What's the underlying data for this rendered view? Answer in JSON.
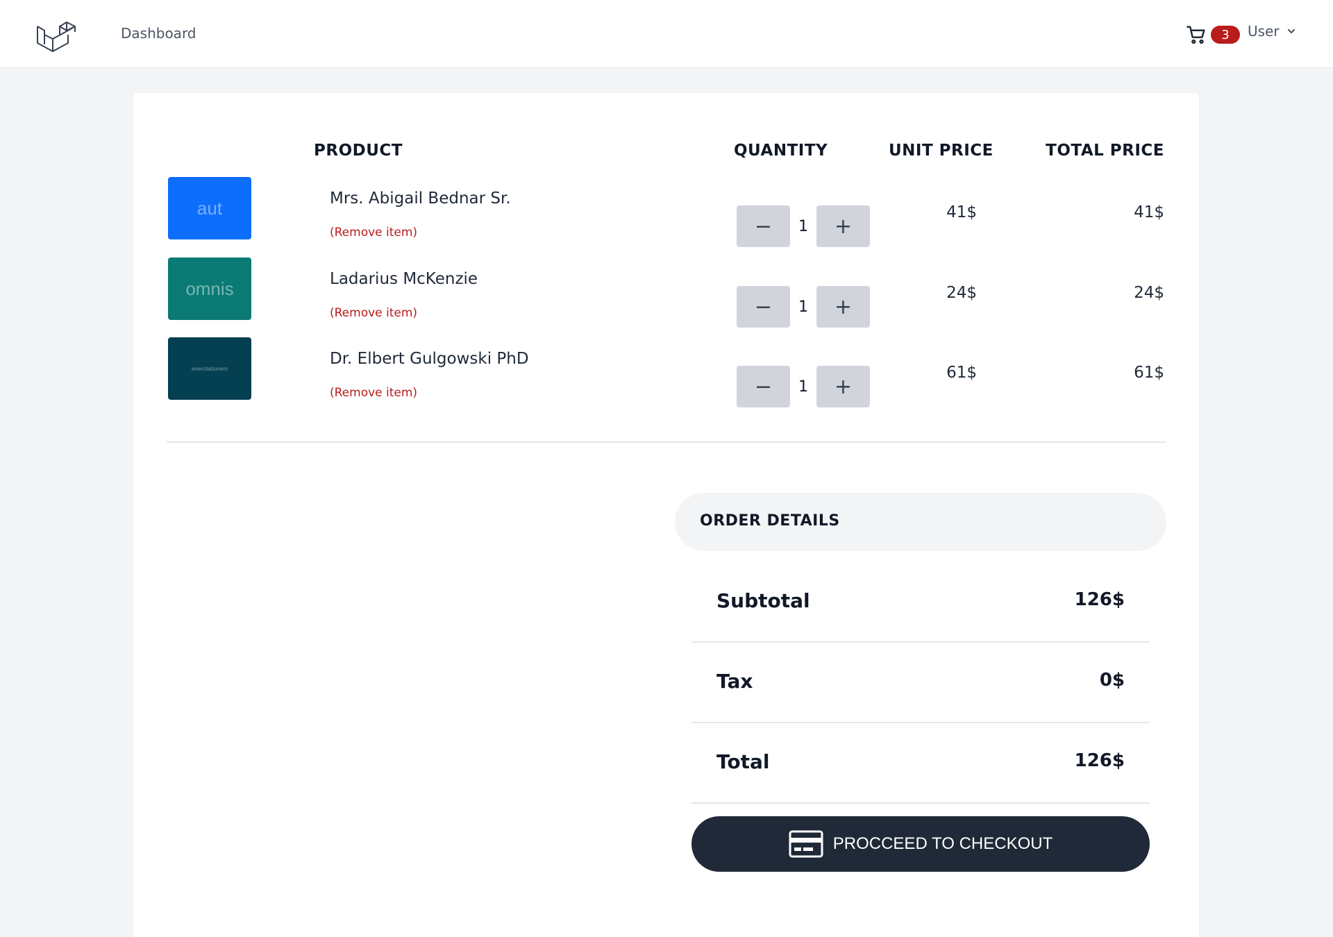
{
  "nav": {
    "logo_icon": "laravel-logo-icon",
    "links": [
      "Dashboard"
    ],
    "cart_icon": "shopping-cart-icon",
    "cart_count": "3",
    "user_label": "User",
    "user_chevron_icon": "chevron-down-icon"
  },
  "table": {
    "headers": {
      "product": "PRODUCT",
      "quantity": "QUANTITY",
      "unit_price": "UNIT PRICE",
      "total_price": "TOTAL PRICE"
    },
    "remove_label": "(Remove item)",
    "decrement_label": "−",
    "increment_label": "+",
    "items": [
      {
        "thumb_text": "aut",
        "thumb_color": "#0d6efd",
        "name": "Mrs. Abigail Bednar Sr.",
        "quantity": "1",
        "unit_price": "41$",
        "total_price": "41$"
      },
      {
        "thumb_text": "omnis",
        "thumb_color": "#0b7a75",
        "name": "Ladarius McKenzie",
        "quantity": "1",
        "unit_price": "24$",
        "total_price": "24$"
      },
      {
        "thumb_text": "exercitationem",
        "thumb_color": "#043f52",
        "name": "Dr. Elbert Gulgowski PhD",
        "quantity": "1",
        "unit_price": "61$",
        "total_price": "61$"
      }
    ]
  },
  "order": {
    "title": "ORDER DETAILS",
    "subtotal_label": "Subtotal",
    "subtotal_value": "126$",
    "tax_label": "Tax",
    "tax_value": "0$",
    "total_label": "Total",
    "total_value": "126$",
    "checkout_label": "PROCCEED TO CHECKOUT",
    "checkout_icon": "credit-card-icon"
  },
  "colors": {
    "accent_dark": "#1f2937",
    "danger": "#b91c1c",
    "page_bg": "#f3f4f6"
  }
}
